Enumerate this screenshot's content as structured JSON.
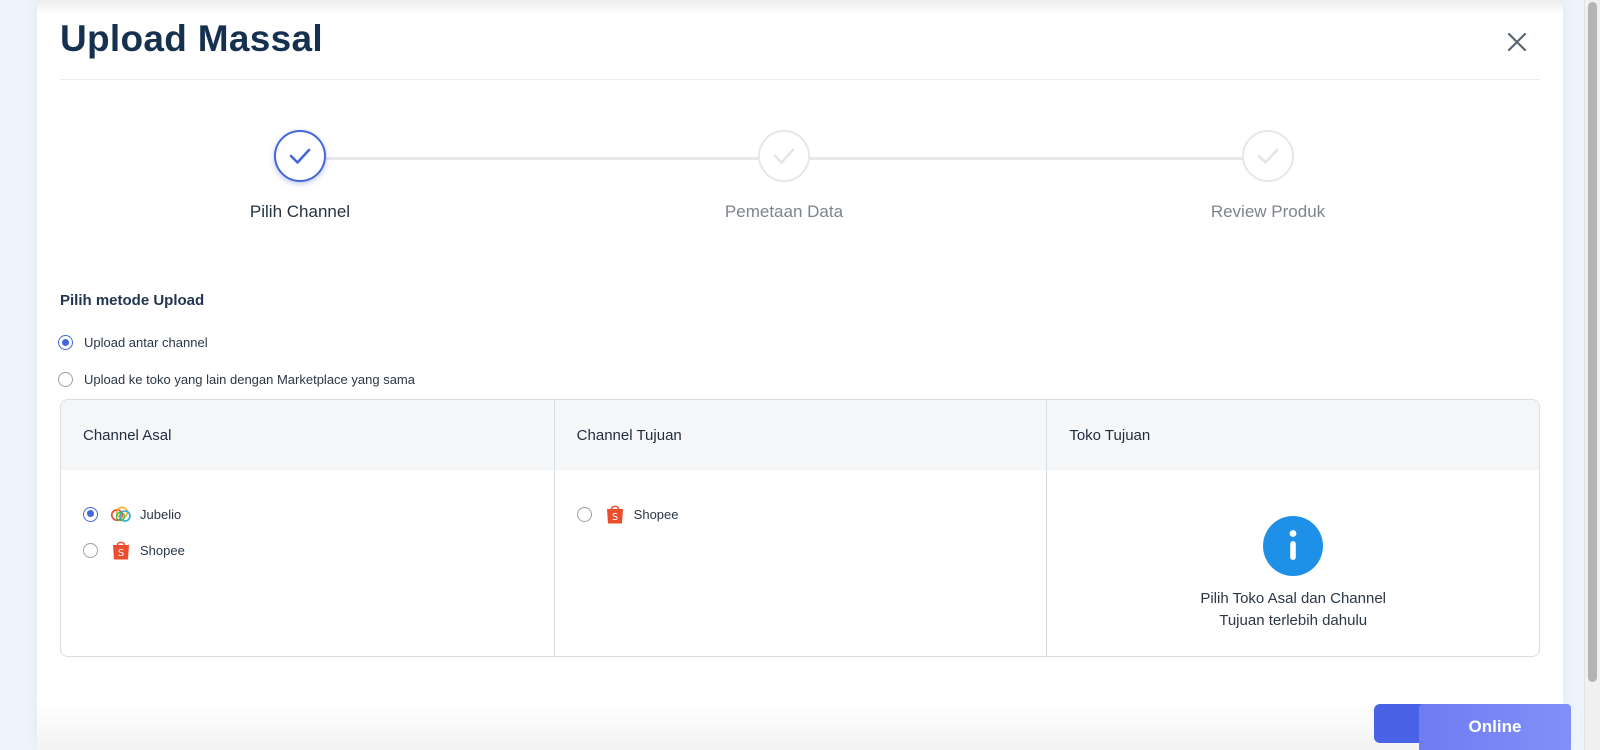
{
  "modal": {
    "title": "Upload Massal",
    "close_icon": "close-icon"
  },
  "stepper": {
    "steps": [
      {
        "label": "Pilih Channel",
        "state": "active"
      },
      {
        "label": "Pemetaan Data",
        "state": "inactive"
      },
      {
        "label": "Review Produk",
        "state": "inactive"
      }
    ]
  },
  "upload_method": {
    "title": "Pilih metode Upload",
    "options": [
      {
        "label": "Upload antar channel",
        "selected": true
      },
      {
        "label": "Upload ke toko yang lain dengan Marketplace yang sama",
        "selected": false
      }
    ]
  },
  "channel_table": {
    "columns": [
      {
        "header": "Channel Asal"
      },
      {
        "header": "Channel Tujuan"
      },
      {
        "header": "Toko Tujuan"
      }
    ],
    "channel_asal": [
      {
        "name": "Jubelio",
        "icon": "jubelio-logo-icon",
        "selected": true
      },
      {
        "name": "Shopee",
        "icon": "shopee-bag-icon",
        "selected": false
      }
    ],
    "channel_tujuan": [
      {
        "name": "Shopee",
        "icon": "shopee-bag-icon",
        "selected": false
      }
    ],
    "toko_tujuan_info": {
      "icon": "info-icon",
      "line1": "Pilih Toko Asal dan Channel",
      "line2": "Tujuan terlebih dahulu"
    }
  },
  "footer": {
    "online_label": "Online"
  },
  "colors": {
    "primary": "#4468d9",
    "title": "#163150",
    "info": "#1e90e8",
    "shopee": "#ee4d2d",
    "online_badge": "#7684f5"
  }
}
